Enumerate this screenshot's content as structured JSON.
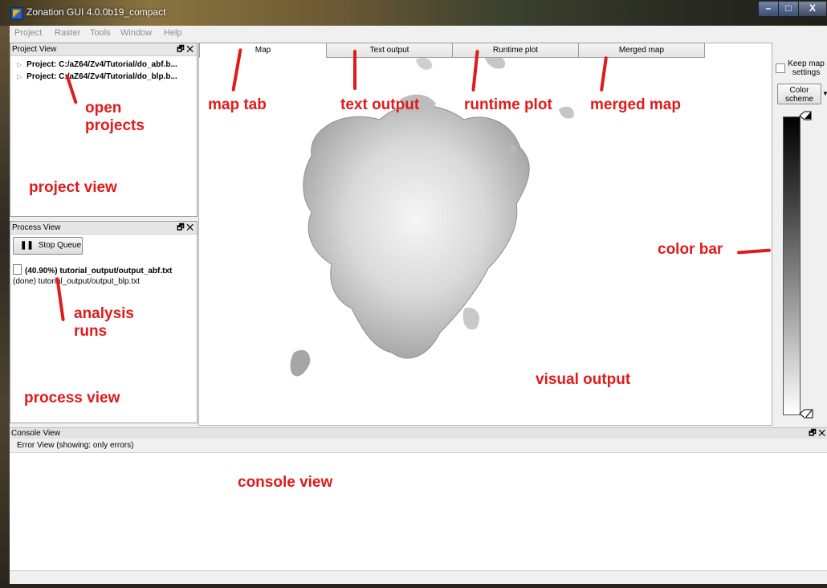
{
  "window": {
    "title": "Zonation GUI 4.0.0b19_compact",
    "minimize": "–",
    "maximize": "□",
    "close": "X"
  },
  "menubar": {
    "items": [
      "Project",
      "Raster",
      "Tools",
      "Window",
      "Help"
    ]
  },
  "project_view": {
    "title": "Project View",
    "controls": "🗗 ✕",
    "projects": [
      "Project: C:/aZ64/Zv4/Tutorial/do_abf.b...",
      "Project: C:/aZ64/Zv4/Tutorial/do_blp.b..."
    ]
  },
  "process_view": {
    "title": "Process View",
    "controls": "🗗 ✕",
    "stop_queue_label": "Stop Queue",
    "runs": [
      {
        "text": "(40.90%) tutorial_output/output_abf.txt",
        "bold": true
      },
      {
        "text": "(done) tutorial_output/output_blp.txt",
        "bold": false
      }
    ]
  },
  "tabs": [
    "Map",
    "Text output",
    "Runtime plot",
    "Merged map"
  ],
  "right_panel": {
    "keep_map_settings": "Keep map settings",
    "color_scheme": "Color scheme"
  },
  "console": {
    "title": "Console View",
    "controls": "🗗 ✕",
    "error_view": "Error View (showing: only errors)"
  },
  "annotations": {
    "open_projects": "open\nprojects",
    "project_view": "project view",
    "analysis_runs": "analysis\nruns",
    "process_view": "process view",
    "map_tab": "map tab",
    "text_output": "text output",
    "runtime_plot": "runtime plot",
    "merged_map": "merged map",
    "color_bar": "color bar",
    "visual_output": "visual output",
    "console_view": "console view"
  },
  "colors": {
    "annotation": "#e01b1b",
    "panel_bg": "#f0f0f0"
  }
}
